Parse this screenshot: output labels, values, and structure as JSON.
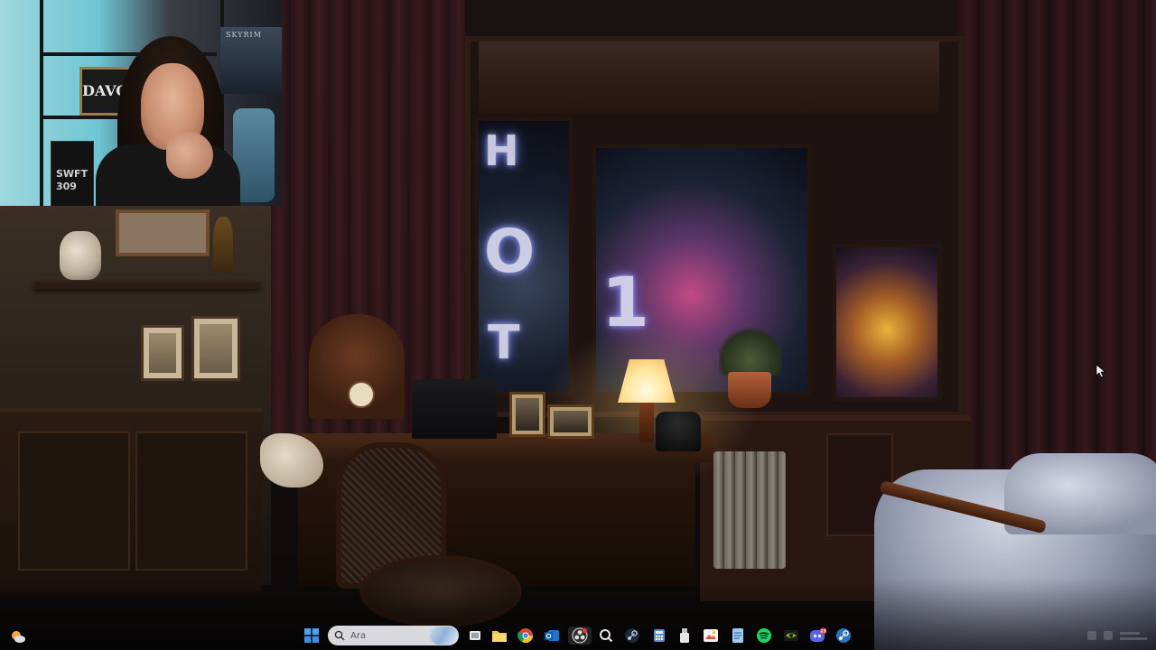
{
  "taskbar": {
    "search": {
      "placeholder": "Ara",
      "value": ""
    },
    "pinned_apps": [
      {
        "name": "start-icon"
      },
      {
        "name": "search-input"
      },
      {
        "name": "task-view-icon"
      },
      {
        "name": "file-explorer-icon"
      },
      {
        "name": "chrome-icon"
      },
      {
        "name": "outlook-icon"
      },
      {
        "name": "obs-icon",
        "active": true
      },
      {
        "name": "search-app-icon"
      },
      {
        "name": "steam-icon"
      },
      {
        "name": "calculator-icon"
      },
      {
        "name": "usb-drive-icon"
      },
      {
        "name": "photo-editor-icon"
      },
      {
        "name": "notepad-icon"
      },
      {
        "name": "spotify-icon"
      },
      {
        "name": "nvidia-icon"
      },
      {
        "name": "discord-icon",
        "badge": "23"
      },
      {
        "name": "steam-alt-icon"
      }
    ],
    "discord_badge": "23"
  },
  "webcam": {
    "sign_text": "DAVOL",
    "poster_text": "SKYRIM",
    "box_text_line1": "SWFT",
    "box_text_line2": "309"
  },
  "wallpaper": {
    "neon_letters": [
      "H",
      "O",
      "T"
    ],
    "neon_number": "1"
  },
  "colors": {
    "accent_blue": "#3b8fe8",
    "spotify_green": "#1ed760",
    "discord_purple": "#5865f2",
    "discord_badge_red": "#e23b3b",
    "nvidia_green": "#76b900"
  }
}
